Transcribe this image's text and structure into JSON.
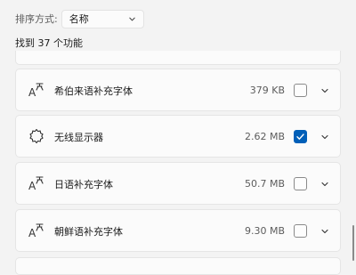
{
  "sort": {
    "label": "排序方式:",
    "value": "名称"
  },
  "results": {
    "text": "找到 37 个功能"
  },
  "features": [
    {
      "name": "希伯来语补充字体",
      "size": "379 KB",
      "checked": false,
      "icon": "font-icon"
    },
    {
      "name": "无线显示器",
      "size": "2.62 MB",
      "checked": true,
      "icon": "gear-icon"
    },
    {
      "name": "日语补充字体",
      "size": "50.7 MB",
      "checked": false,
      "icon": "font-icon"
    },
    {
      "name": "朝鲜语补充字体",
      "size": "9.30 MB",
      "checked": false,
      "icon": "font-icon"
    }
  ],
  "colors": {
    "accent": "#005fb8",
    "background": "#f3f3f3",
    "card": "#fbfbfb"
  }
}
